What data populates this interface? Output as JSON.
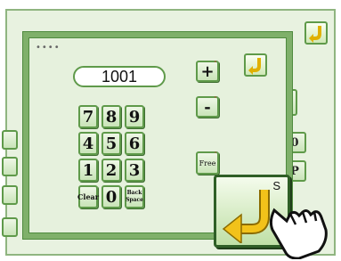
{
  "background": {
    "side_right": [
      "0",
      "P"
    ],
    "top_right_icon": "undo-arrow-icon"
  },
  "popup": {
    "indicator": "••••",
    "display_value": "1001",
    "keys": [
      [
        "7",
        "8",
        "9"
      ],
      [
        "4",
        "5",
        "6"
      ],
      [
        "1",
        "2",
        "3"
      ]
    ],
    "clear_label": "Clear",
    "zero_label": "0",
    "backspace_label": "Back Space",
    "plus_label": "+",
    "minus_label": "-",
    "free_label": "Free",
    "undo_icon": "undo-arrow-icon"
  },
  "highlight": {
    "badge": "S",
    "icon": "undo-arrow-icon",
    "cursor": "hand-pointer-icon"
  },
  "colors": {
    "accent": "#5f9a4a",
    "panel": "#e6f1dd",
    "arrow": "#f2c21a"
  }
}
